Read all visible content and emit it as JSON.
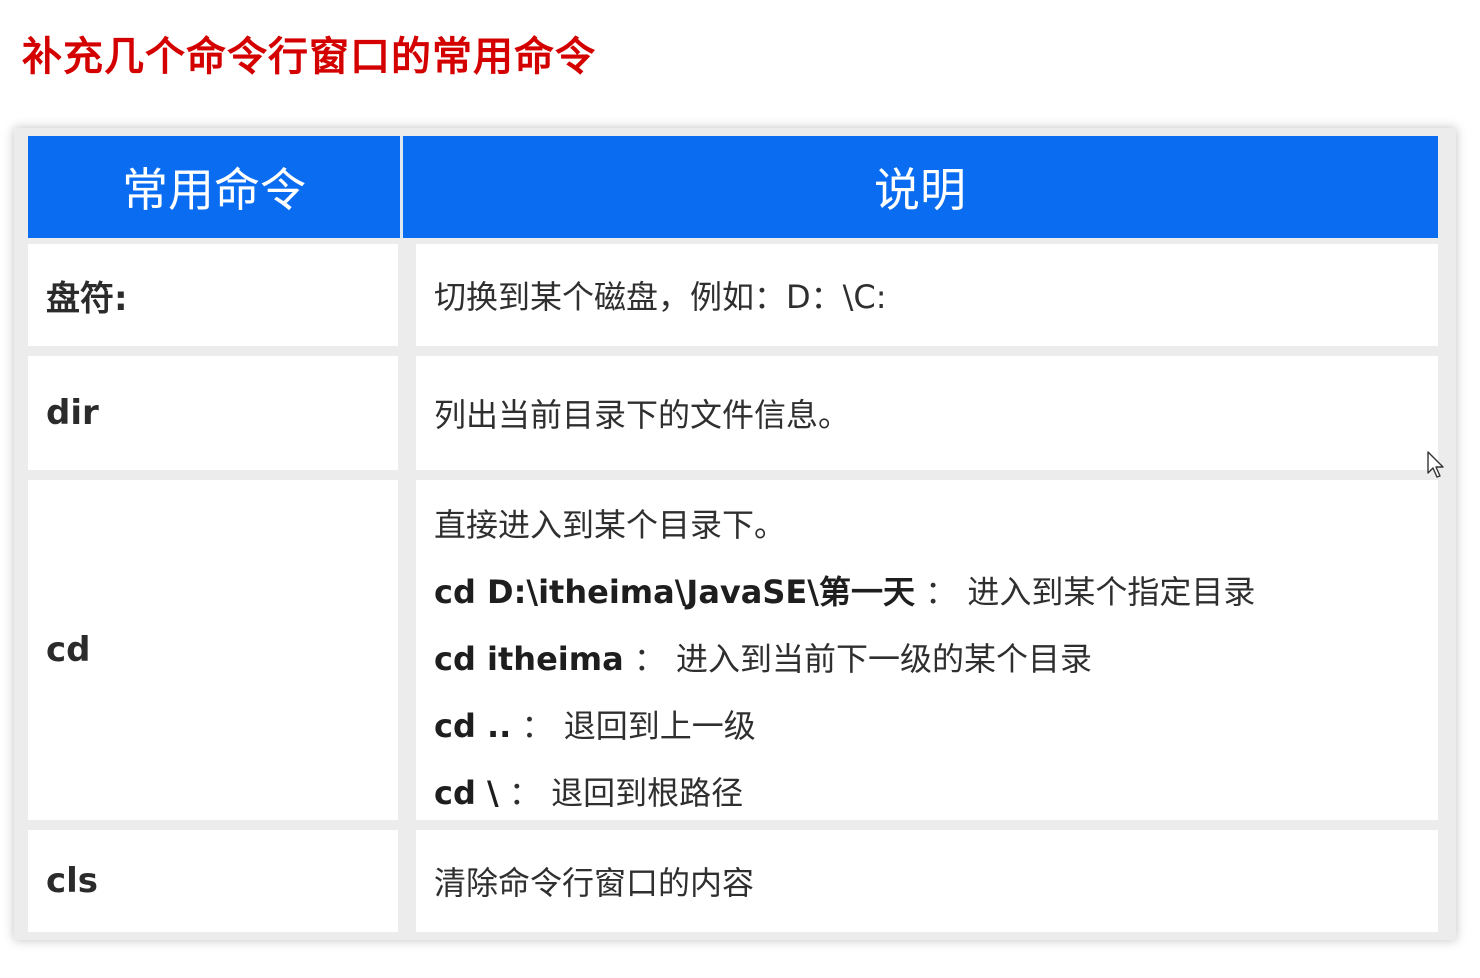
{
  "page": {
    "title": "补充几个命令行窗口的常用命令"
  },
  "table": {
    "headers": {
      "command": "常用命令",
      "description": "说明"
    },
    "rows": [
      {
        "command": "盘符:",
        "description": "切换到某个磁盘，例如：D：\\C:"
      },
      {
        "command": "dir",
        "description": "列出当前目录下的文件信息。"
      },
      {
        "command": "cd",
        "description_lines": [
          {
            "code": "",
            "sep": "",
            "text": "直接进入到某个目录下。"
          },
          {
            "code": "cd  D:\\itheima\\JavaSE\\第一天",
            "sep": " ：  ",
            "text": "进入到某个指定目录"
          },
          {
            "code": "cd  itheima",
            "sep": " ：  ",
            "text": "进入到当前下一级的某个目录"
          },
          {
            "code": "cd ..",
            "sep": "  ：  ",
            "text": "退回到上一级"
          },
          {
            "code": "cd \\",
            "sep": "  ：  ",
            "text": "退回到根路径"
          }
        ]
      },
      {
        "command": "cls",
        "description": "清除命令行窗口的内容"
      }
    ]
  },
  "colors": {
    "title": "#d40000",
    "header_background": "#0a6df1",
    "header_text": "#ffffff"
  },
  "icons": {
    "cursor": "mouse-pointer-icon"
  }
}
